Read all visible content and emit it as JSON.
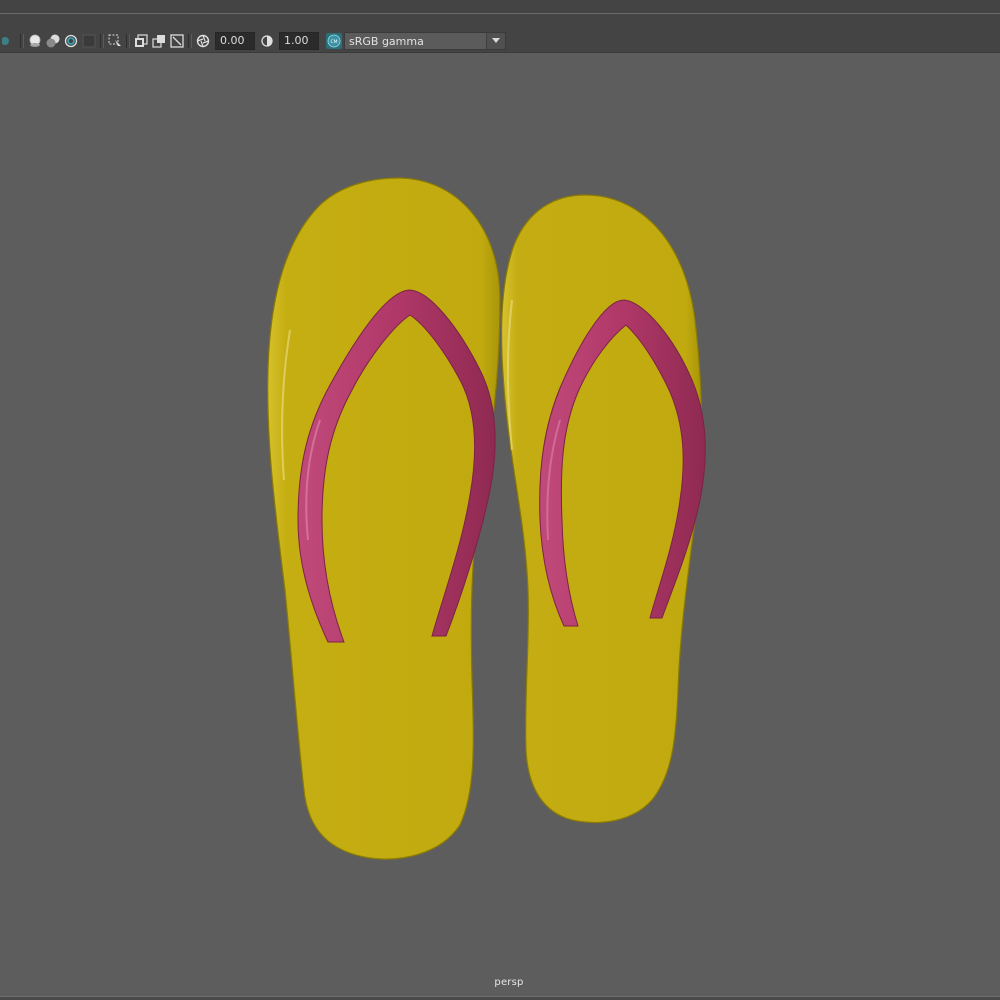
{
  "toolbar": {
    "exposure_value": "0.00",
    "gamma_value": "1.00",
    "colorspace_badge": "CM",
    "view_transform": "sRGB gamma",
    "icons": [
      "shading-icon",
      "xray-icon",
      "isolate-icon",
      "wireframe-icon",
      "texture-icon",
      "select-camera-icon",
      "grid-toggle-icon",
      "resolution-gate-icon",
      "film-gate-icon",
      "exposure-icon",
      "gamma-icon",
      "color-management-icon"
    ]
  },
  "viewport": {
    "camera_name": "persp",
    "background_color": "#5d5d5d",
    "sole_color": "#c2ab10",
    "strap_color": "#b03868"
  }
}
